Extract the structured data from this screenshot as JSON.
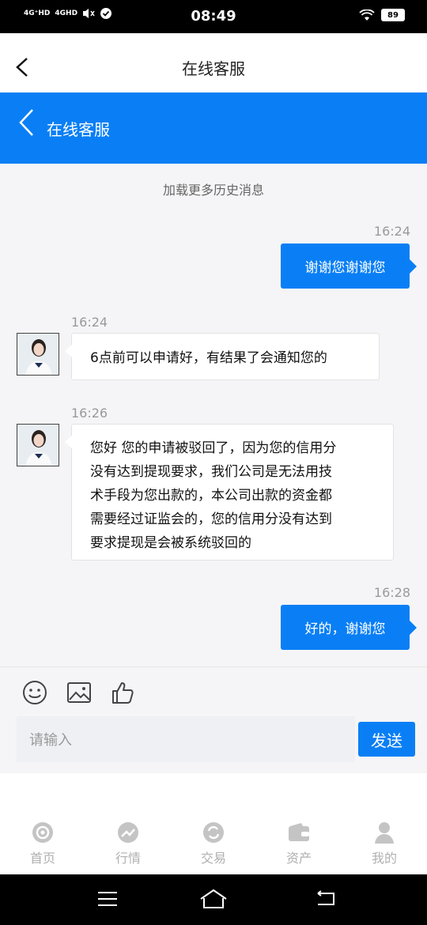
{
  "status_bar": {
    "time": "08:49",
    "network1": "4G⁺HD",
    "network2": "4GHD",
    "battery": "89"
  },
  "header": {
    "title": "在线客服"
  },
  "blue_header": {
    "title": "在线客服"
  },
  "chat": {
    "load_more": "加载更多历史消息",
    "messages": [
      {
        "direction": "out",
        "time": "16:24",
        "text": "谢谢您谢谢您"
      },
      {
        "direction": "in",
        "time": "16:24",
        "text": "6点前可以申请好，有结果了会通知您的"
      },
      {
        "direction": "in",
        "time": "16:26",
        "lines": [
          "您好 您的申请被驳回了，因为您的信用分",
          "没有达到提现要求，我们公司是无法用技",
          "术手段为您出款的，本公司出款的资金都",
          "需要经过证监会的，您的信用分没有达到",
          "要求提现是会被系统驳回的"
        ]
      },
      {
        "direction": "out",
        "time": "16:28",
        "text": "好的，谢谢您"
      }
    ]
  },
  "composer": {
    "placeholder": "请输入",
    "send_label": "发送"
  },
  "tabs": [
    {
      "label": "首页",
      "icon": "home-icon"
    },
    {
      "label": "行情",
      "icon": "market-icon"
    },
    {
      "label": "交易",
      "icon": "trade-icon"
    },
    {
      "label": "资产",
      "icon": "wallet-icon"
    },
    {
      "label": "我的",
      "icon": "user-icon"
    }
  ],
  "colors": {
    "accent": "#0a7ff5",
    "tab_inactive": "#b0b0b0"
  }
}
